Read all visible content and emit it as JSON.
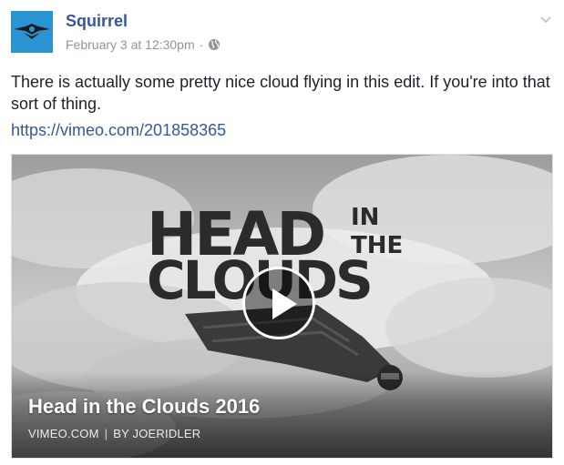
{
  "post": {
    "author": "Squirrel",
    "timestamp": "February 3 at 12:30pm",
    "separator": "·",
    "privacy_icon": "globe-icon",
    "text": "There is actually some pretty nice cloud flying in this edit. If you're into that sort of thing.",
    "link": "https://vimeo.com/201858365"
  },
  "card": {
    "title": "Head in the Clouds 2016",
    "domain": "VIMEO.COM",
    "byline": "BY JOERIDLER",
    "pipe": "|",
    "logo_lines": [
      "HEAD",
      "IN",
      "THE",
      "CLOUDS"
    ]
  },
  "colors": {
    "link": "#365899",
    "meta": "#90949c",
    "avatar_bg": "#2b95d4"
  }
}
